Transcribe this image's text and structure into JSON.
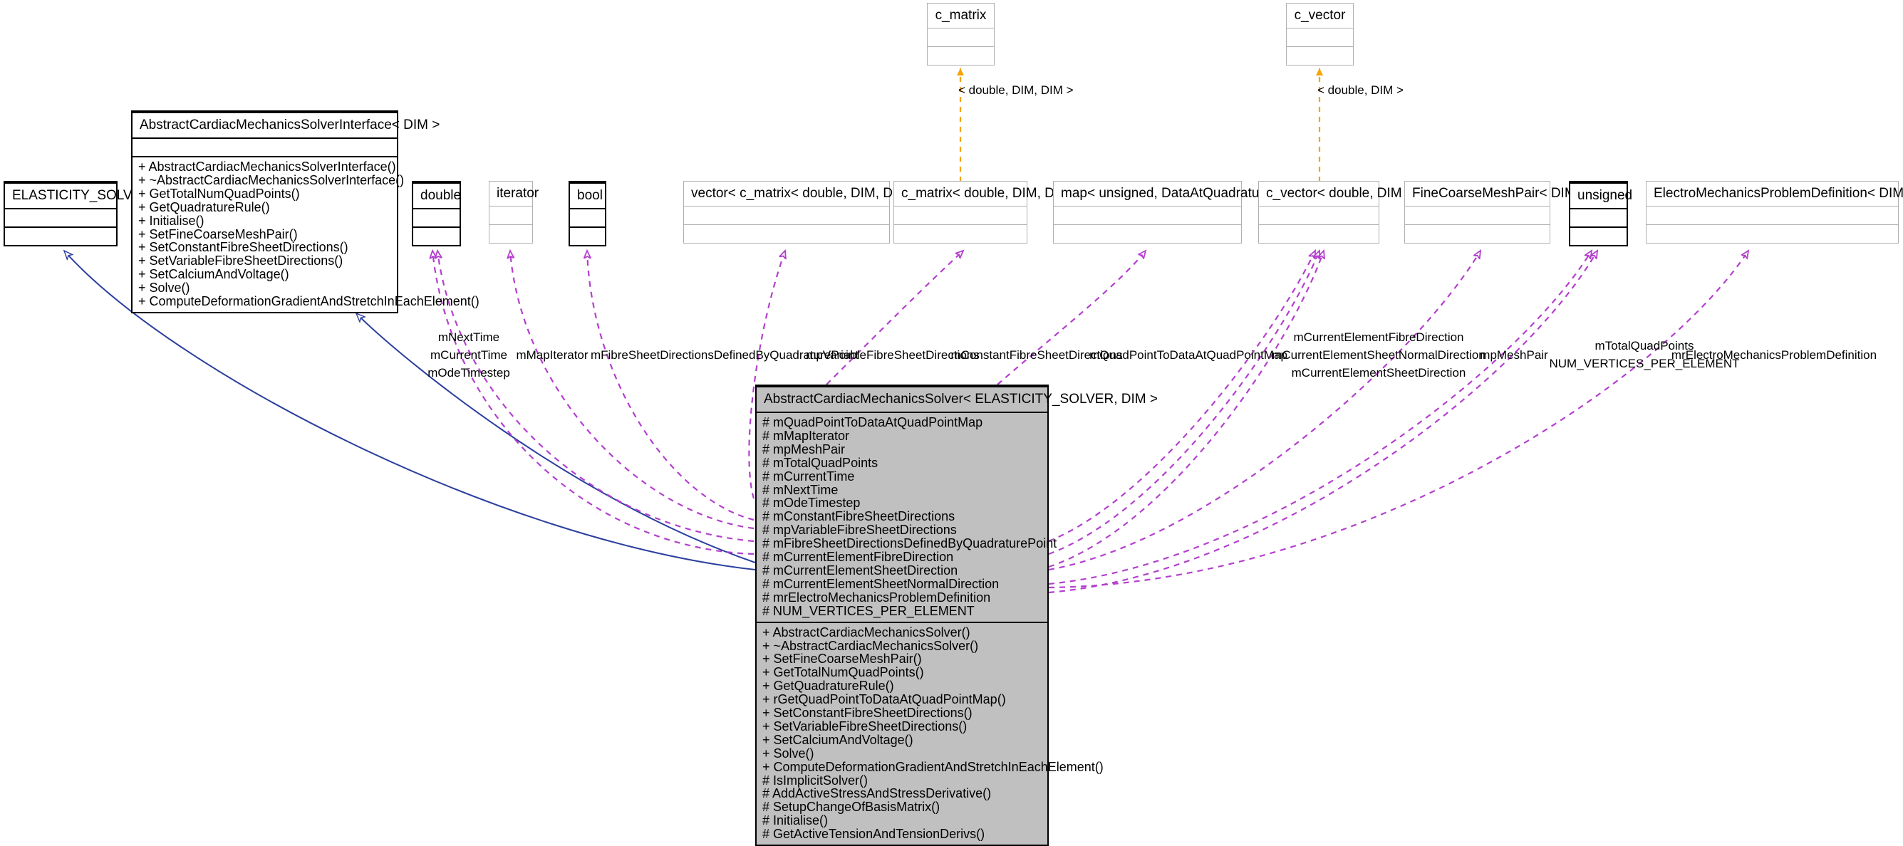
{
  "diagram": {
    "kind": "uml-collaboration-diagram",
    "focal_class": "AbstractCardiacMechanicsSolver< ELASTICITY_SOLVER, DIM >",
    "colors": {
      "inheritance_edge": "#2c3f9e",
      "usage_edge": "#b43fce",
      "template_edge": "#f6a200",
      "focal_fill": "#c0c0c0",
      "box_border_light": "#b0b0b0",
      "box_border_strong": "#000000",
      "background": "#ffffff"
    }
  },
  "classes": {
    "elasticity_solver": {
      "title": "ELASTICITY_SOLVER",
      "attributes": [],
      "methods": []
    },
    "interface": {
      "title": "AbstractCardiacMechanicsSolverInterface< DIM >",
      "attributes": [],
      "methods": [
        "+ AbstractCardiacMechanicsSolverInterface()",
        "+ ~AbstractCardiacMechanicsSolverInterface()",
        "+ GetTotalNumQuadPoints()",
        "+ GetQuadratureRule()",
        "+ Initialise()",
        "+ SetFineCoarseMeshPair()",
        "+ SetConstantFibreSheetDirections()",
        "+ SetVariableFibreSheetDirections()",
        "+ SetCalciumAndVoltage()",
        "+ Solve()",
        "+ ComputeDeformationGradientAndStretchInEachElement()"
      ]
    },
    "c_matrix": {
      "title": "c_matrix",
      "attributes": [],
      "methods": []
    },
    "c_vector": {
      "title": "c_vector",
      "attributes": [],
      "methods": []
    },
    "double": {
      "title": "double",
      "attributes": [],
      "methods": []
    },
    "iterator": {
      "title": "iterator",
      "attributes": [],
      "methods": []
    },
    "bool": {
      "title": "bool",
      "attributes": [],
      "methods": []
    },
    "vector_c_matrix_ptr": {
      "title": "vector< c_matrix< double, DIM, DIM > > *",
      "attributes": [],
      "methods": []
    },
    "c_matrix_double_dim_dim": {
      "title": "c_matrix< double, DIM, DIM >",
      "attributes": [],
      "methods": []
    },
    "map_unsigned_data": {
      "title": "map< unsigned, DataAtQuadraturePoint >",
      "attributes": [],
      "methods": []
    },
    "c_vector_double_dim": {
      "title": "c_vector< double, DIM >",
      "attributes": [],
      "methods": []
    },
    "fine_coarse_mesh_pair_ptr": {
      "title": "FineCoarseMeshPair< DIM > *",
      "attributes": [],
      "methods": []
    },
    "unsigned": {
      "title": "unsigned",
      "attributes": [],
      "methods": []
    },
    "electro_problem_def_ref": {
      "title": "ElectroMechanicsProblemDefinition< DIM > &",
      "attributes": [],
      "methods": []
    },
    "focal": {
      "title": "AbstractCardiacMechanicsSolver< ELASTICITY_SOLVER, DIM >",
      "attributes": [
        "# mQuadPointToDataAtQuadPointMap",
        "# mMapIterator",
        "# mpMeshPair",
        "# mTotalQuadPoints",
        "# mCurrentTime",
        "# mNextTime",
        "# mOdeTimestep",
        "# mConstantFibreSheetDirections",
        "# mpVariableFibreSheetDirections",
        "# mFibreSheetDirectionsDefinedByQuadraturePoint",
        "# mCurrentElementFibreDirection",
        "# mCurrentElementSheetDirection",
        "# mCurrentElementSheetNormalDirection",
        "# mrElectroMechanicsProblemDefinition",
        "# NUM_VERTICES_PER_ELEMENT"
      ],
      "methods": [
        "+ AbstractCardiacMechanicsSolver()",
        "+ ~AbstractCardiacMechanicsSolver()",
        "+ SetFineCoarseMeshPair()",
        "+ GetTotalNumQuadPoints()",
        "+ GetQuadratureRule()",
        "+ rGetQuadPointToDataAtQuadPointMap()",
        "+ SetConstantFibreSheetDirections()",
        "+ SetVariableFibreSheetDirections()",
        "+ SetCalciumAndVoltage()",
        "+ Solve()",
        "+ ComputeDeformationGradientAndStretchInEachElement()",
        "# IsImplicitSolver()",
        "# AddActiveStressAndStressDerivative()",
        "# SetupChangeOfBasisMatrix()",
        "# Initialise()",
        "# GetActiveTensionAndTensionDerivs()"
      ]
    }
  },
  "edge_labels": {
    "tmpl_c_matrix": "< double, DIM, DIM >",
    "tmpl_c_vector": "< double, DIM >",
    "next_time": "mNextTime",
    "current_time": "mCurrentTime",
    "ode_timestep": "mOdeTimestep",
    "map_iterator": "mMapIterator",
    "fibre_defined_by_quad": "mFibreSheetDirectionsDefinedByQuadraturePoint",
    "variable_fibre": "mpVariableFibreSheetDirections",
    "constant_fibre": "mConstantFibreSheetDirections",
    "quad_point_map": "mQuadPointToDataAtQuadPointMap",
    "cur_elem_fibre": "mCurrentElementFibreDirection",
    "cur_elem_sheet_normal": "mCurrentElementSheetNormalDirection",
    "cur_elem_sheet": "mCurrentElementSheetDirection",
    "mesh_pair": "mpMeshPair",
    "total_quad_points": "mTotalQuadPoints",
    "num_vertices": "NUM_VERTICES_PER_ELEMENT",
    "electro_problem_def": "mrElectroMechanicsProblemDefinition"
  }
}
